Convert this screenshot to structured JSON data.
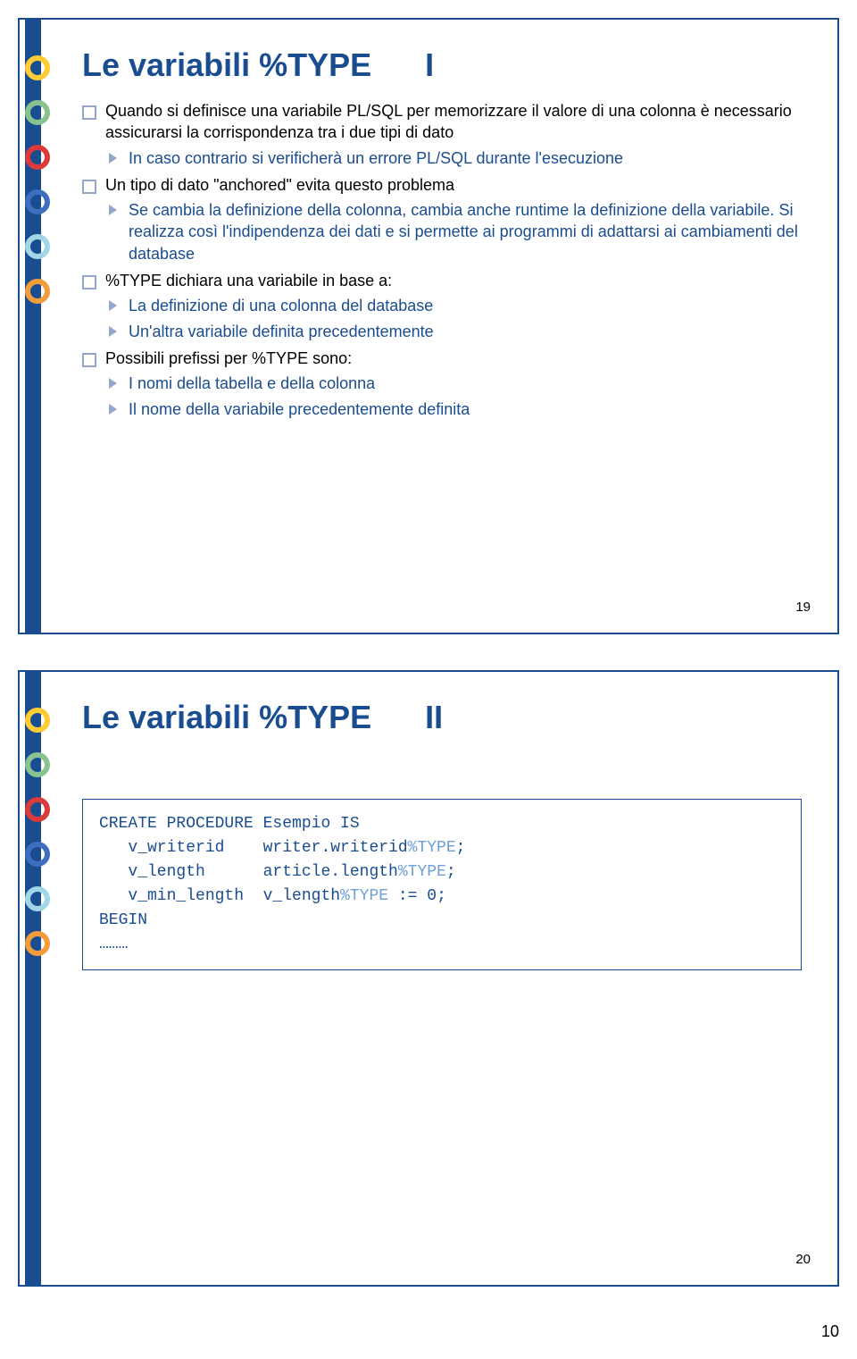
{
  "slide1": {
    "title_main": "Le variabili %TYPE",
    "title_part": "I",
    "items": [
      {
        "text": "Quando si definisce una variabile PL/SQL per memorizzare il valore di una colonna è necessario assicurarsi la corrispondenza tra i due tipi di dato",
        "subs": [
          "In caso contrario si verificherà un errore PL/SQL durante l'esecuzione"
        ]
      },
      {
        "text": "Un tipo di dato \"anchored\" evita questo problema",
        "subs": [
          "Se cambia la definizione della colonna, cambia anche runtime la definizione della variabile. Si realizza così l'indipendenza dei dati e si permette ai programmi di adattarsi ai cambiamenti del database"
        ]
      },
      {
        "text": "%TYPE dichiara una variabile in base a:",
        "subs": [
          "La definizione di una colonna del database",
          "Un'altra variabile definita precedentemente"
        ]
      },
      {
        "text": "Possibili prefissi per %TYPE sono:",
        "subs": [
          "I nomi della tabella e della colonna",
          "Il nome della variabile precedentemente definita"
        ]
      }
    ],
    "slide_num": "19"
  },
  "slide2": {
    "title_main": "Le variabili %TYPE",
    "title_part": "II",
    "code": {
      "l1": "CREATE PROCEDURE Esempio IS",
      "l2a": "   v_writerid    writer.writerid",
      "l2b": "%TYPE",
      "l2c": ";",
      "l3a": "   v_length      article.length",
      "l3b": "%TYPE",
      "l3c": ";",
      "l4a": "   v_min_length  v_length",
      "l4b": "%TYPE",
      "l4c": " := 0;",
      "l5": "BEGIN",
      "l6": "………"
    },
    "slide_num": "20"
  },
  "page_number": "10"
}
